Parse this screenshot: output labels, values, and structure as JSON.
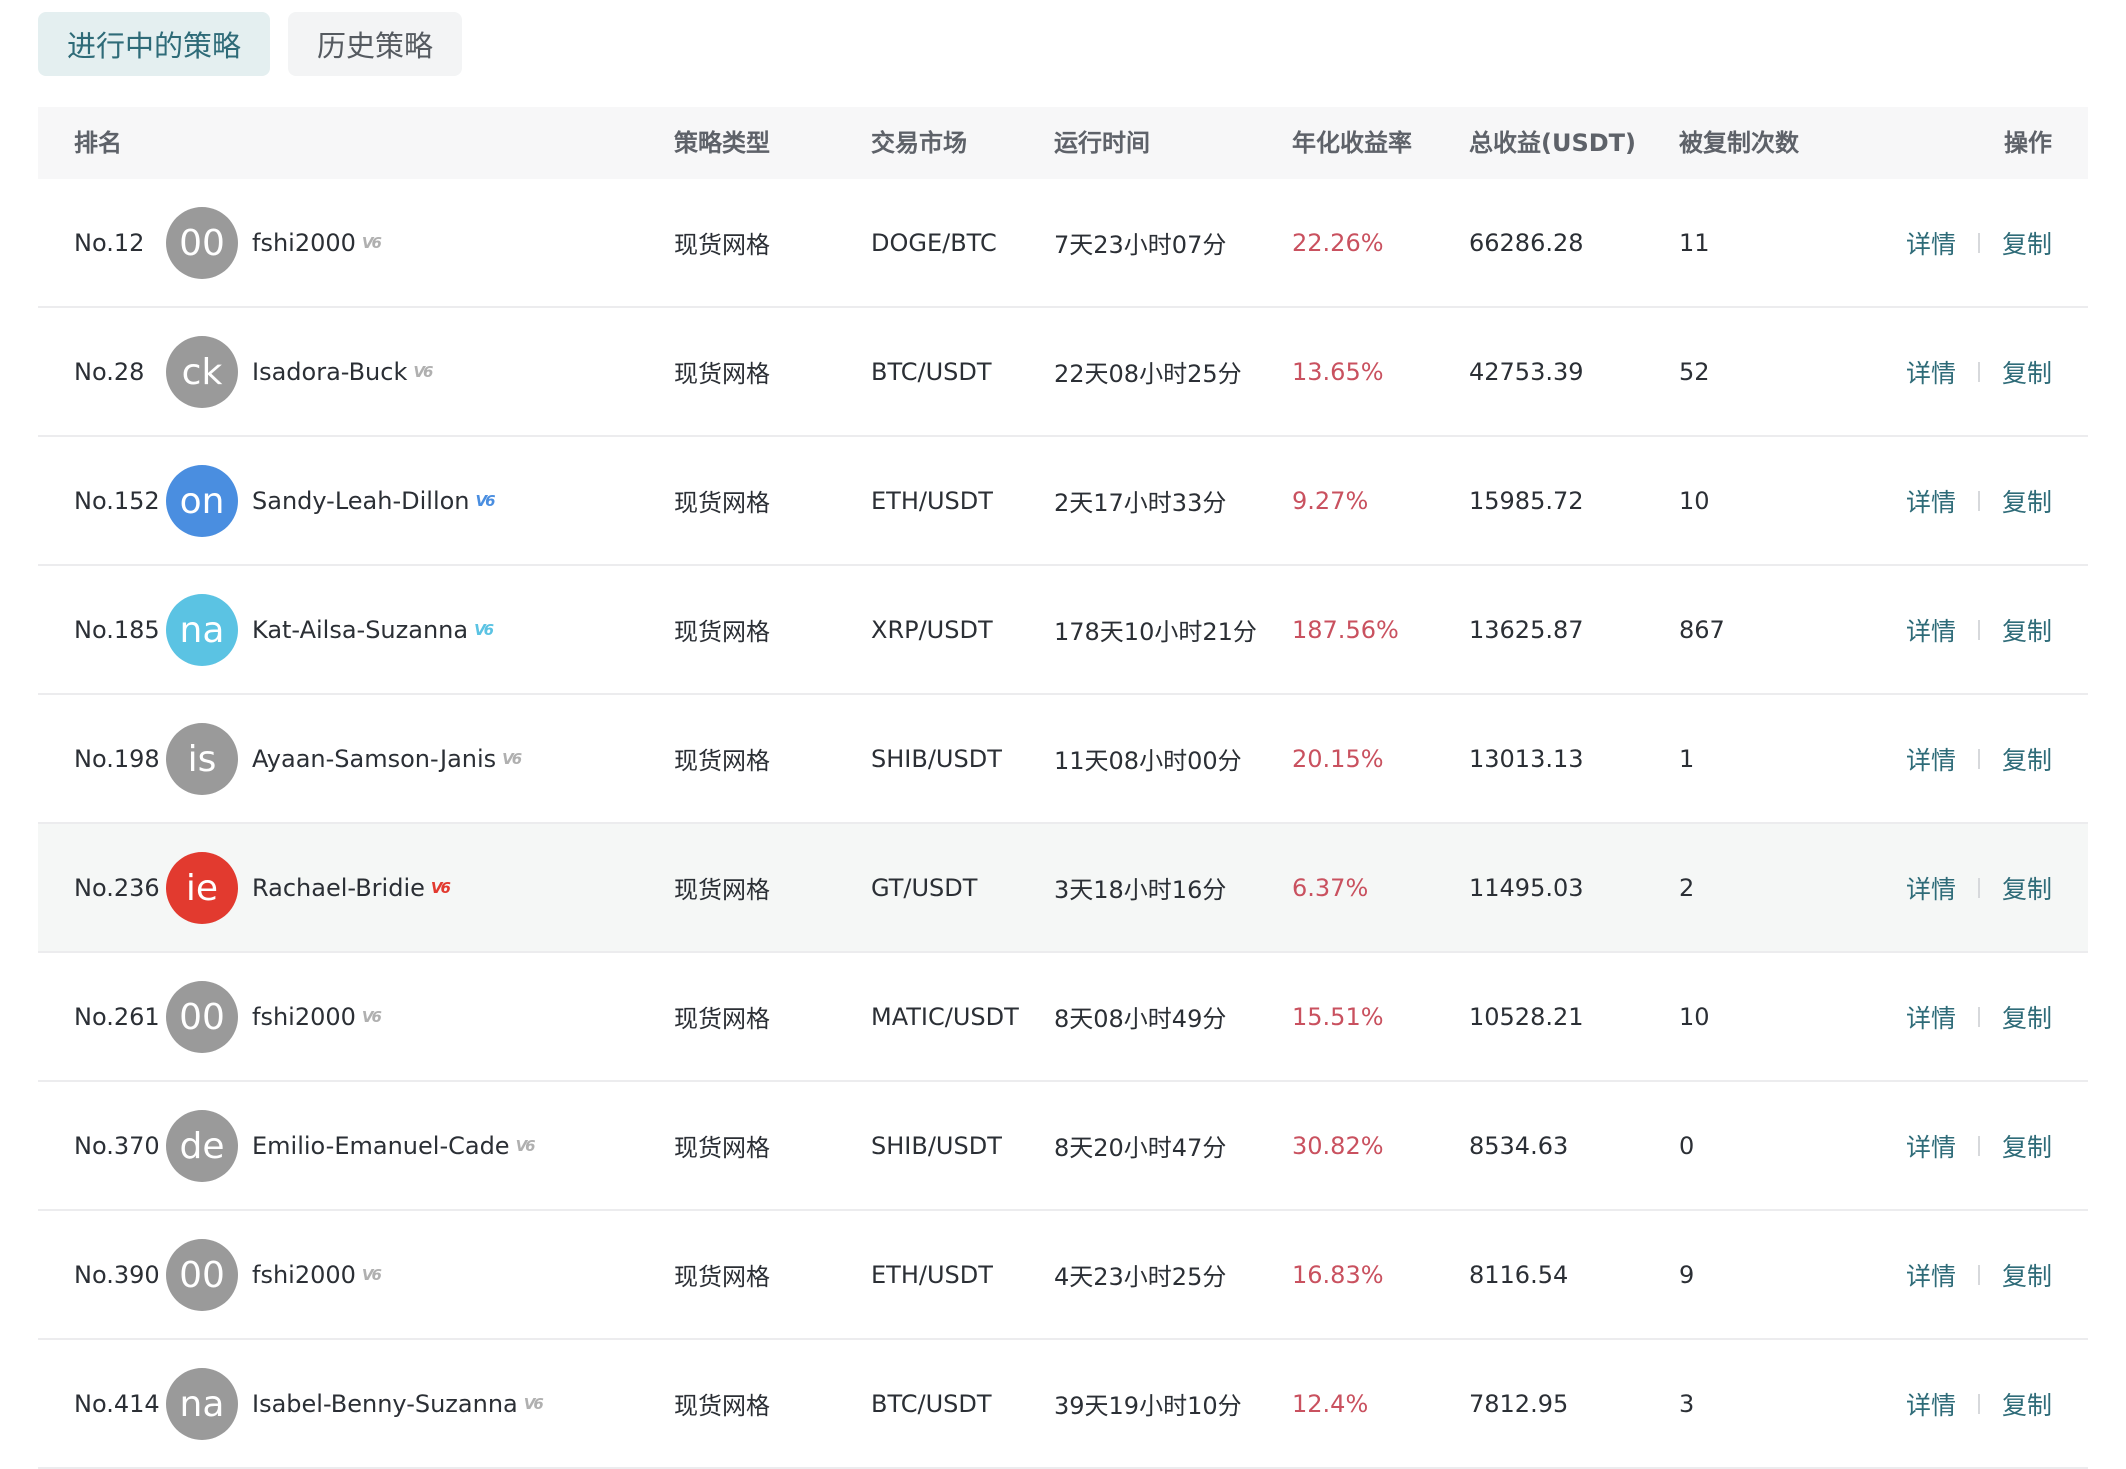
{
  "tabs": [
    {
      "label": "进行中的策略",
      "active": true
    },
    {
      "label": "历史策略",
      "active": false
    }
  ],
  "columns": {
    "rank": "排名",
    "type": "策略类型",
    "market": "交易市场",
    "runtime": "运行时间",
    "annual": "年化收益率",
    "profit": "总收益(USDT)",
    "copies": "被复制次数",
    "action": "操作"
  },
  "actions": {
    "detail": "详情",
    "copy": "复制"
  },
  "colors": {
    "accent": "#2e6b78",
    "rate": "#c9515f",
    "avatar_gray": "#9a9a9a",
    "avatar_blue": "#4a8ee0",
    "avatar_cyan": "#5bc3e3",
    "avatar_red": "#e23a2f"
  },
  "rows": [
    {
      "rank": "No.12",
      "avatar": "00",
      "avatar_color": "#9a9a9a",
      "name": "fshi2000",
      "vip_color": "#b0b0b0",
      "type": "现货网格",
      "market": "DOGE/BTC",
      "runtime": "7天23小时07分",
      "annual": "22.26%",
      "profit": "66286.28",
      "copies": "11",
      "highlight": false
    },
    {
      "rank": "No.28",
      "avatar": "ck",
      "avatar_color": "#9a9a9a",
      "name": "Isadora-Buck",
      "vip_color": "#b0b0b0",
      "type": "现货网格",
      "market": "BTC/USDT",
      "runtime": "22天08小时25分",
      "annual": "13.65%",
      "profit": "42753.39",
      "copies": "52",
      "highlight": false
    },
    {
      "rank": "No.152",
      "avatar": "on",
      "avatar_color": "#4a8ee0",
      "name": "Sandy-Leah-Dillon",
      "vip_color": "#4a8ee0",
      "type": "现货网格",
      "market": "ETH/USDT",
      "runtime": "2天17小时33分",
      "annual": "9.27%",
      "profit": "15985.72",
      "copies": "10",
      "highlight": false
    },
    {
      "rank": "No.185",
      "avatar": "na",
      "avatar_color": "#5bc3e3",
      "name": "Kat-Ailsa-Suzanna",
      "vip_color": "#5bc3e3",
      "type": "现货网格",
      "market": "XRP/USDT",
      "runtime": "178天10小时21分",
      "annual": "187.56%",
      "profit": "13625.87",
      "copies": "867",
      "highlight": false
    },
    {
      "rank": "No.198",
      "avatar": "is",
      "avatar_color": "#9a9a9a",
      "name": "Ayaan-Samson-Janis",
      "vip_color": "#b0b0b0",
      "type": "现货网格",
      "market": "SHIB/USDT",
      "runtime": "11天08小时00分",
      "annual": "20.15%",
      "profit": "13013.13",
      "copies": "1",
      "highlight": false
    },
    {
      "rank": "No.236",
      "avatar": "ie",
      "avatar_color": "#e23a2f",
      "name": "Rachael-Bridie",
      "vip_color": "#e23a2f",
      "type": "现货网格",
      "market": "GT/USDT",
      "runtime": "3天18小时16分",
      "annual": "6.37%",
      "profit": "11495.03",
      "copies": "2",
      "highlight": true
    },
    {
      "rank": "No.261",
      "avatar": "00",
      "avatar_color": "#9a9a9a",
      "name": "fshi2000",
      "vip_color": "#b0b0b0",
      "type": "现货网格",
      "market": "MATIC/USDT",
      "runtime": "8天08小时49分",
      "annual": "15.51%",
      "profit": "10528.21",
      "copies": "10",
      "highlight": false
    },
    {
      "rank": "No.370",
      "avatar": "de",
      "avatar_color": "#9a9a9a",
      "name": "Emilio-Emanuel-Cade",
      "vip_color": "#b0b0b0",
      "type": "现货网格",
      "market": "SHIB/USDT",
      "runtime": "8天20小时47分",
      "annual": "30.82%",
      "profit": "8534.63",
      "copies": "0",
      "highlight": false
    },
    {
      "rank": "No.390",
      "avatar": "00",
      "avatar_color": "#9a9a9a",
      "name": "fshi2000",
      "vip_color": "#b0b0b0",
      "type": "现货网格",
      "market": "ETH/USDT",
      "runtime": "4天23小时25分",
      "annual": "16.83%",
      "profit": "8116.54",
      "copies": "9",
      "highlight": false
    },
    {
      "rank": "No.414",
      "avatar": "na",
      "avatar_color": "#9a9a9a",
      "name": "Isabel-Benny-Suzanna",
      "vip_color": "#b0b0b0",
      "type": "现货网格",
      "market": "BTC/USDT",
      "runtime": "39天19小时10分",
      "annual": "12.4%",
      "profit": "7812.95",
      "copies": "3",
      "highlight": false
    }
  ]
}
